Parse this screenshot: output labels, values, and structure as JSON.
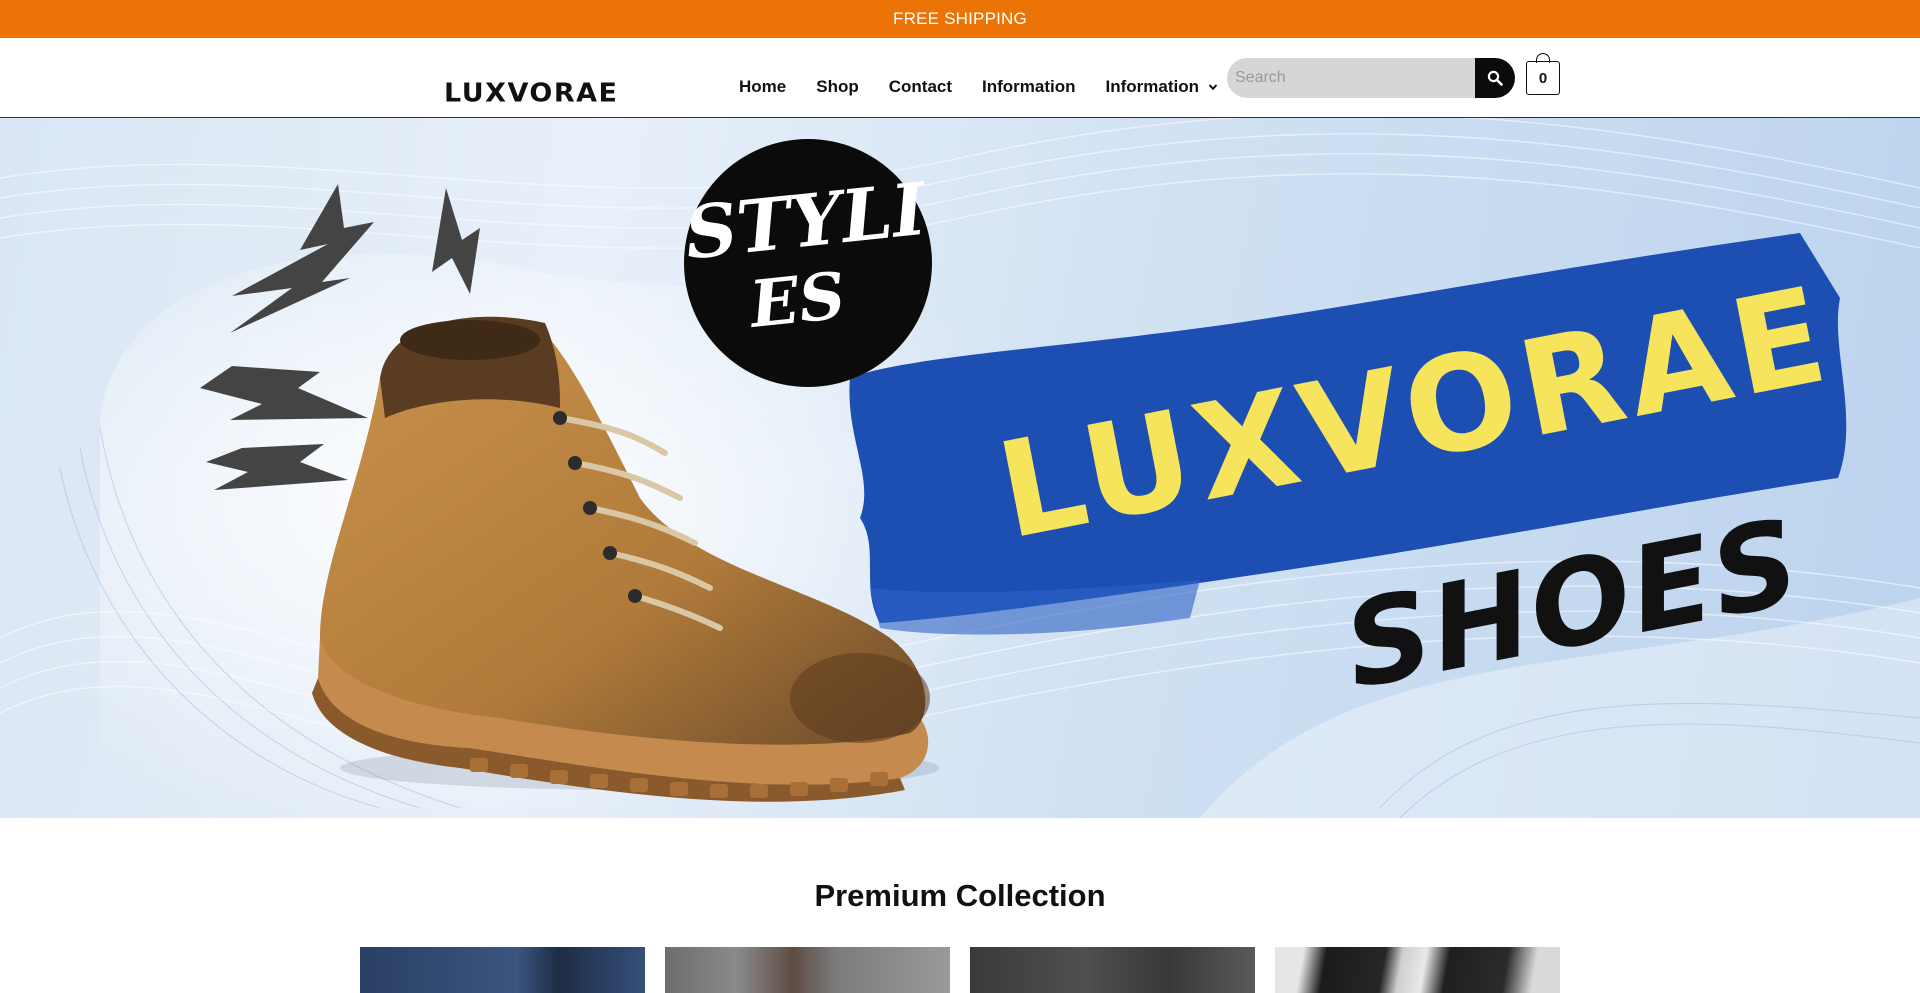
{
  "announcement": {
    "text": "FREE SHIPPING"
  },
  "header": {
    "logo": "LUXVORAE",
    "nav": [
      "Home",
      "Shop",
      "Contact",
      "Information",
      "Information"
    ],
    "search_placeholder": "Search",
    "cart_count": "0"
  },
  "hero": {
    "badge_line1": "STYLI",
    "badge_line2": "ES",
    "headline": "LUXVORAE",
    "subheadline": "SHOES"
  },
  "section": {
    "title": "Premium Collection"
  },
  "colors": {
    "announcement_bg": "#ec7406",
    "brush_blue": "#1d4fb3",
    "headline_yellow": "#f6e45c"
  }
}
